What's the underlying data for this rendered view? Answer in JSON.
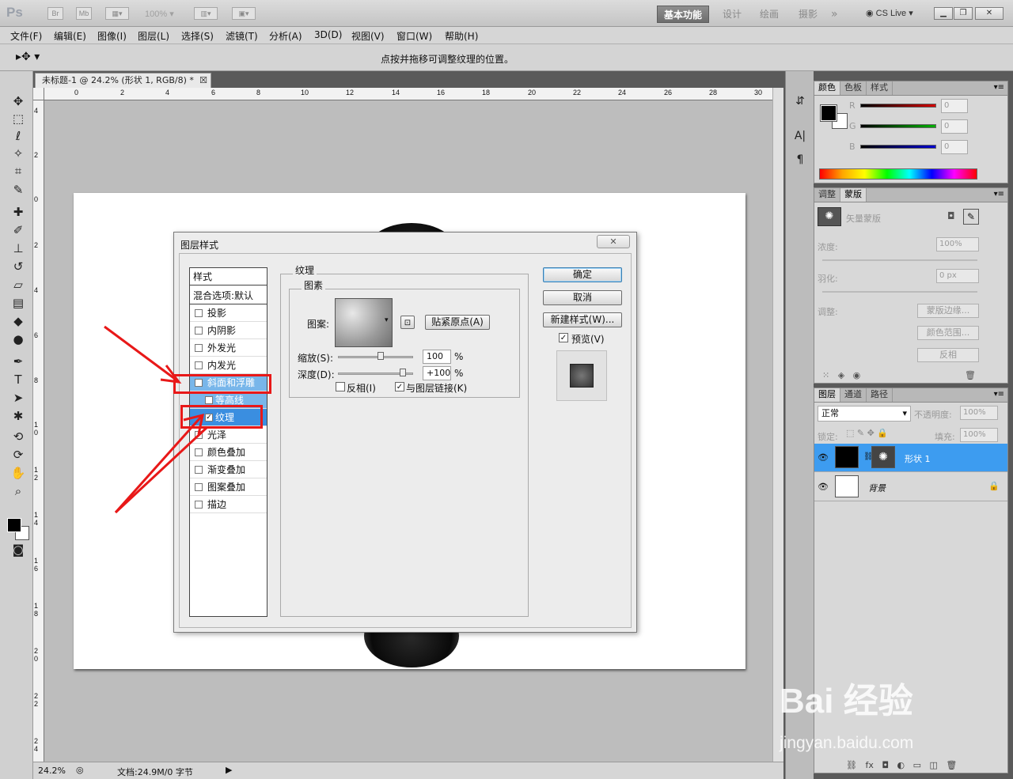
{
  "app": {
    "logo": "Ps",
    "br": "Br",
    "mb": "Mb",
    "zoom": "100%",
    "workspaces": [
      "基本功能",
      "设计",
      "绘画",
      "摄影"
    ],
    "more": "»",
    "cslive": "CS Live"
  },
  "menu": [
    "文件(F)",
    "编辑(E)",
    "图像(I)",
    "图层(L)",
    "选择(S)",
    "滤镜(T)",
    "分析(A)",
    "3D(D)",
    "视图(V)",
    "窗口(W)",
    "帮助(H)"
  ],
  "options": {
    "hint": "点按并拖移可调整纹理的位置。"
  },
  "document": {
    "tab": "未标题-1 @ 24.2% (形状 1, RGB/8) *",
    "ruler_top": [
      "0",
      "2",
      "4",
      "6",
      "8",
      "10",
      "12",
      "14",
      "16",
      "18",
      "20",
      "22",
      "24",
      "26",
      "28",
      "30"
    ],
    "ruler_left": [
      "4",
      "2",
      "0",
      "2",
      "4",
      "6",
      "8",
      "1 0",
      "1 2",
      "1 4",
      "1 6",
      "1 8",
      "2 0",
      "2 2",
      "2 4"
    ]
  },
  "status": {
    "zoom": "24.2%",
    "doc": "文档:24.9M/0 字节"
  },
  "dialog": {
    "title": "图层样式",
    "close": "✕",
    "style_list": {
      "header": "样式",
      "blend": "混合选项:默认",
      "items": [
        {
          "label": "投影",
          "checked": false
        },
        {
          "label": "内阴影",
          "checked": false
        },
        {
          "label": "外发光",
          "checked": false
        },
        {
          "label": "内发光",
          "checked": false
        },
        {
          "label": "斜面和浮雕",
          "checked": true
        },
        {
          "label": "等高线",
          "checked": false
        },
        {
          "label": "纹理",
          "checked": true
        },
        {
          "label": "光泽",
          "checked": false
        },
        {
          "label": "颜色叠加",
          "checked": false
        },
        {
          "label": "渐变叠加",
          "checked": false
        },
        {
          "label": "图案叠加",
          "checked": false
        },
        {
          "label": "描边",
          "checked": false
        }
      ]
    },
    "texture": {
      "group": "纹理",
      "sub_group": "图素",
      "pattern_label": "图案:",
      "snap_button": "贴紧原点(A)",
      "scale_label": "缩放(S):",
      "scale_value": "100",
      "depth_label": "深度(D):",
      "depth_value": "+100",
      "percent": "%",
      "invert_label": "反相(I)",
      "invert_checked": false,
      "link_label": "与图层链接(K)",
      "link_checked": true
    },
    "buttons": {
      "ok": "确定",
      "cancel": "取消",
      "new_style": "新建样式(W)...",
      "preview_label": "预览(V)",
      "preview_checked": true
    }
  },
  "panels": {
    "color": {
      "tabs": [
        "颜色",
        "色板",
        "样式"
      ],
      "channels": [
        {
          "name": "R",
          "value": "0",
          "color": "#d40000"
        },
        {
          "name": "G",
          "value": "0",
          "color": "#00b000"
        },
        {
          "name": "B",
          "value": "0",
          "color": "#0000d0"
        }
      ]
    },
    "masks": {
      "tabs": [
        "调整",
        "蒙版"
      ],
      "vector_mask": "矢量蒙版",
      "density_label": "浓度:",
      "density_value": "100%",
      "feather_label": "羽化:",
      "feather_value": "0 px",
      "adjust_label": "调整:",
      "edge_button": "蒙版边缘...",
      "color_range_button": "颜色范围...",
      "invert_button": "反相"
    },
    "layers": {
      "tabs": [
        "图层",
        "通道",
        "路径"
      ],
      "blend_mode": "正常",
      "opacity_label": "不透明度:",
      "opacity_value": "100%",
      "lock_label": "锁定:",
      "fill_label": "填充:",
      "fill_value": "100%",
      "layers": [
        {
          "name": "形状 1",
          "selected": true
        },
        {
          "name": "背景",
          "selected": false
        }
      ]
    }
  },
  "watermark": {
    "brand": "Bai 经验",
    "url": "jingyan.baidu.com"
  },
  "colors": {
    "accent": "#3d9cf0",
    "annotation": "#e81818"
  }
}
